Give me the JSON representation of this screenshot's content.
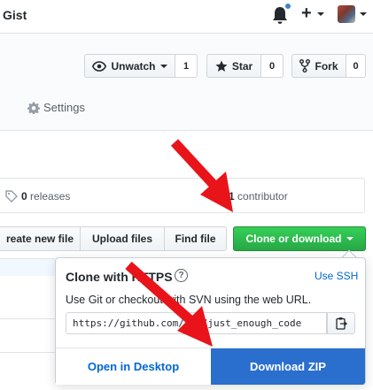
{
  "header": {
    "title": "Gist",
    "icons": [
      "bell-icon",
      "plus-icon",
      "avatar"
    ],
    "notification_color": "#4184c4"
  },
  "repo_actions": {
    "watch": {
      "label": "Unwatch",
      "count": "1",
      "icon": "eye-icon"
    },
    "star": {
      "label": "Star",
      "count": "0",
      "icon": "star-icon"
    },
    "fork": {
      "label": "Fork",
      "count": "0",
      "icon": "fork-icon"
    }
  },
  "tabs": {
    "settings": "Settings"
  },
  "summary": {
    "releases_count": "0",
    "releases_label": " releases",
    "contributors_count": "1",
    "contributors_label": " contributor"
  },
  "file_nav": {
    "create_new_file": "reate new file",
    "upload_files": "Upload files",
    "find_file": "Find file",
    "clone_or_download": "Clone or download",
    "clone_button_color": "#28a745"
  },
  "clone_dropdown": {
    "title": "Clone with HTTPS",
    "use_ssh": "Use SSH",
    "description": "Use Git or checkout with SVN using the web URL.",
    "url": "https://github.com/.../just_enough_code",
    "open_in_desktop": "Open in Desktop",
    "download_zip": "Download ZIP",
    "download_zip_color": "#2b6fce"
  },
  "annotations": {
    "arrow_color": "#e8141a",
    "arrows": [
      "red-arrow-to-clone-button",
      "red-arrow-to-download-zip"
    ]
  }
}
